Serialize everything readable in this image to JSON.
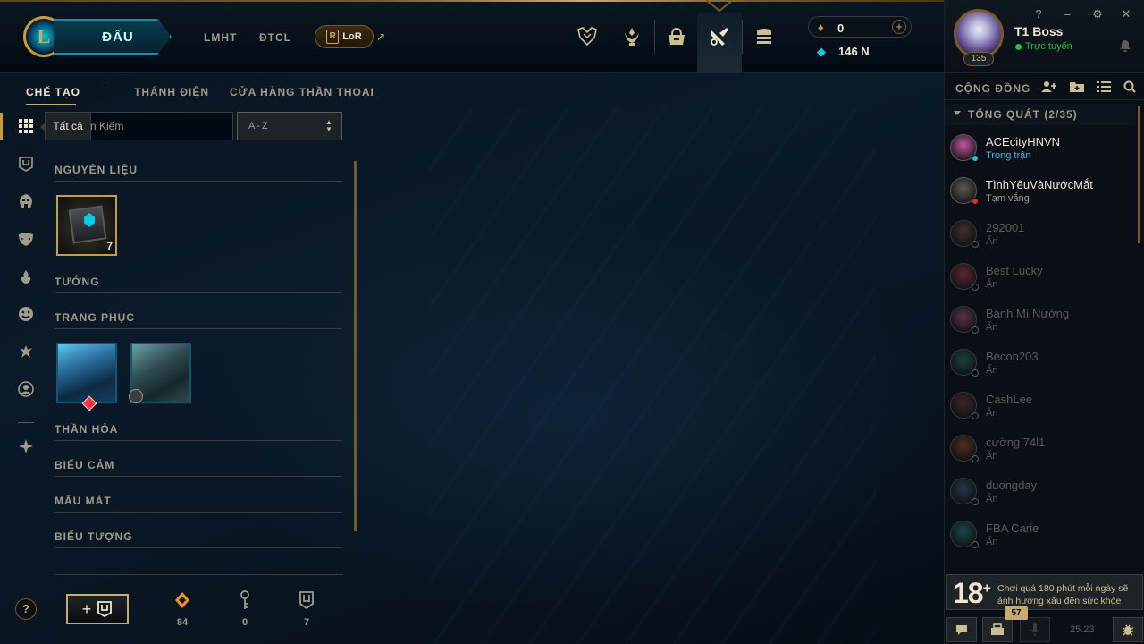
{
  "header": {
    "logo_letter": "L",
    "play_label": "ĐẤU",
    "nav_links": [
      "LMHT",
      "ĐTCL"
    ],
    "lor_label": "LoR",
    "lor_letter": "R",
    "ext_arrow": "↗",
    "nav_icons": [
      "worlds-icon",
      "ranked-icon",
      "store-icon",
      "crafting-icon",
      "loot-icon"
    ],
    "rp": "0",
    "rp_add": "+",
    "be": "146 N"
  },
  "profile": {
    "name": "T1 Boss",
    "status": "Trực tuyến",
    "level": "135",
    "window_buttons": [
      "?",
      "–",
      "⚙",
      "✕"
    ]
  },
  "collection": {
    "tabs": [
      "CHẾ TẠO",
      "THÁNH ĐIỆN",
      "CỬA HÀNG THẦN THOẠI"
    ],
    "tooltip": "Tất cả",
    "search_text": "n Kiếm",
    "sort_value": "A-Z",
    "categories": [
      "NGUYÊN LIỆU",
      "TƯỚNG",
      "TRANG PHỤC",
      "THẦN HỎA",
      "BIỂU CẢM",
      "MẪU MẮT",
      "BIỂU TƯỢNG"
    ],
    "chest_count": "7",
    "help": "?",
    "craft_plus": "+",
    "resources": [
      {
        "icon": "orange-essence-icon",
        "value": "84"
      },
      {
        "icon": "key-icon",
        "value": "0"
      },
      {
        "icon": "chest-icon",
        "value": "7"
      }
    ]
  },
  "social": {
    "title": "CỘNG ĐỒNG",
    "group": "TỔNG QUÁT (2/35)",
    "friends": [
      {
        "name": "ACEcityHNVN",
        "status": "Trong trận",
        "state": "ingame"
      },
      {
        "name": "TìnhYêuVàNướcMắt",
        "status": "Tạm vắng",
        "state": "away"
      },
      {
        "name": "292001",
        "status": "Ẩn",
        "state": "offline"
      },
      {
        "name": "Best Lucky",
        "status": "Ẩn",
        "state": "offline"
      },
      {
        "name": "Bánh Mì Nướng",
        "status": "Ẩn",
        "state": "offline"
      },
      {
        "name": "Bécon203",
        "status": "Ẩn",
        "state": "offline"
      },
      {
        "name": "CashLee",
        "status": "Ẩn",
        "state": "offline"
      },
      {
        "name": "cường 74l1",
        "status": "Ẩn",
        "state": "offline"
      },
      {
        "name": "duongday",
        "status": "Ẩn",
        "state": "offline"
      },
      {
        "name": "FBA Carie",
        "status": "Ẩn",
        "state": "offline"
      }
    ],
    "warning_age": "18",
    "warning_plus": "+",
    "warning_text": "Chơi quá 180 phút mỗi ngày sẽ ảnh hưởng xấu đến sức khỏe",
    "badge": "57",
    "version": "25.23"
  },
  "colors": {
    "gold": "#c8aa6e",
    "online": "#1ec13b",
    "ingame": "#0acbe6",
    "away": "#e0283c"
  }
}
